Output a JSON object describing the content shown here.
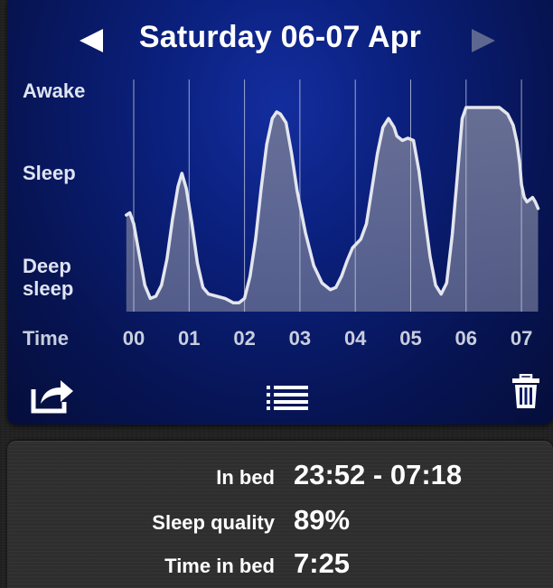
{
  "header": {
    "date_title": "Saturday 06-07 Apr",
    "prev_icon": "left-triangle-icon",
    "next_icon": "right-triangle-icon"
  },
  "chart_data": {
    "type": "area",
    "title": "",
    "y_labels": [
      "Awake",
      "Sleep",
      "Deep",
      "sleep"
    ],
    "x_axis_title": "Time",
    "categories": [
      "00",
      "01",
      "02",
      "03",
      "04",
      "05",
      "06",
      "07"
    ],
    "x_range_hours": [
      -0.1333,
      7.3
    ],
    "y_range": [
      0,
      1
    ],
    "series": [
      {
        "points": [
          [
            -0.1333,
            0.44
          ],
          [
            -0.07,
            0.45
          ],
          [
            0.0,
            0.4
          ],
          [
            0.1,
            0.26
          ],
          [
            0.2,
            0.12
          ],
          [
            0.3,
            0.06
          ],
          [
            0.4,
            0.07
          ],
          [
            0.5,
            0.12
          ],
          [
            0.6,
            0.24
          ],
          [
            0.7,
            0.42
          ],
          [
            0.8,
            0.57
          ],
          [
            0.87,
            0.63
          ],
          [
            0.95,
            0.56
          ],
          [
            1.05,
            0.4
          ],
          [
            1.15,
            0.22
          ],
          [
            1.25,
            0.11
          ],
          [
            1.35,
            0.08
          ],
          [
            1.5,
            0.07
          ],
          [
            1.65,
            0.06
          ],
          [
            1.8,
            0.04
          ],
          [
            1.9,
            0.04
          ],
          [
            2.0,
            0.06
          ],
          [
            2.1,
            0.16
          ],
          [
            2.2,
            0.33
          ],
          [
            2.3,
            0.56
          ],
          [
            2.4,
            0.76
          ],
          [
            2.5,
            0.88
          ],
          [
            2.58,
            0.91
          ],
          [
            2.65,
            0.9
          ],
          [
            2.75,
            0.86
          ],
          [
            2.85,
            0.72
          ],
          [
            2.95,
            0.55
          ],
          [
            3.1,
            0.36
          ],
          [
            3.25,
            0.21
          ],
          [
            3.4,
            0.13
          ],
          [
            3.55,
            0.1
          ],
          [
            3.65,
            0.11
          ],
          [
            3.75,
            0.16
          ],
          [
            3.85,
            0.23
          ],
          [
            3.95,
            0.29
          ],
          [
            4.1,
            0.33
          ],
          [
            4.2,
            0.4
          ],
          [
            4.3,
            0.56
          ],
          [
            4.4,
            0.72
          ],
          [
            4.5,
            0.84
          ],
          [
            4.6,
            0.88
          ],
          [
            4.7,
            0.84
          ],
          [
            4.75,
            0.8
          ],
          [
            4.85,
            0.78
          ],
          [
            4.95,
            0.79
          ],
          [
            5.05,
            0.78
          ],
          [
            5.15,
            0.64
          ],
          [
            5.25,
            0.44
          ],
          [
            5.35,
            0.25
          ],
          [
            5.45,
            0.12
          ],
          [
            5.55,
            0.08
          ],
          [
            5.65,
            0.13
          ],
          [
            5.75,
            0.35
          ],
          [
            5.85,
            0.64
          ],
          [
            5.93,
            0.88
          ],
          [
            6.0,
            0.93
          ],
          [
            6.15,
            0.93
          ],
          [
            6.3,
            0.93
          ],
          [
            6.45,
            0.93
          ],
          [
            6.6,
            0.93
          ],
          [
            6.75,
            0.9
          ],
          [
            6.85,
            0.85
          ],
          [
            6.92,
            0.77
          ],
          [
            6.97,
            0.67
          ],
          [
            7.0,
            0.58
          ],
          [
            7.05,
            0.52
          ],
          [
            7.1,
            0.5
          ],
          [
            7.2,
            0.52
          ],
          [
            7.25,
            0.5
          ],
          [
            7.3,
            0.47
          ]
        ]
      }
    ],
    "colors": {
      "line": "#e4e6ee",
      "fill": "#6c7396",
      "gridline": "#cfd3e3"
    }
  },
  "toolbar": {
    "share_icon": "share-icon",
    "list_icon": "list-icon",
    "trash_icon": "trash-icon"
  },
  "summary": {
    "rows": [
      {
        "label": "In bed",
        "value": "23:52 - 07:18"
      },
      {
        "label": "Sleep quality",
        "value": "89%"
      },
      {
        "label": "Time in bed",
        "value": "7:25"
      }
    ]
  }
}
